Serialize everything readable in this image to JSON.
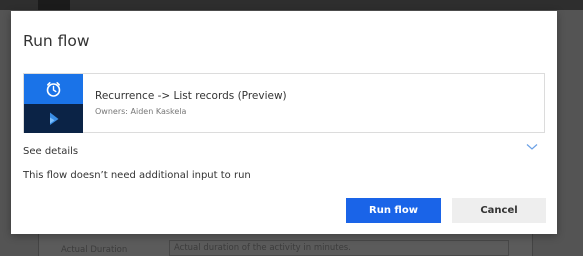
{
  "dialog": {
    "title": "Run flow",
    "flow": {
      "name": "Recurrence -> List records (Preview)",
      "owners": "Owners: Aiden Kaskela",
      "icons": [
        "alarm-clock-icon",
        "dynamics-icon"
      ]
    },
    "see_details": "See details",
    "message": "This flow doesn’t need additional input to run",
    "buttons": {
      "run": "Run flow",
      "cancel": "Cancel"
    }
  },
  "background": {
    "field_label": "Actual Duration",
    "field_value": "Actual duration of the activity in minutes."
  },
  "colors": {
    "primary": "#1a64e8",
    "icon_top": "#1a73e8",
    "icon_bottom": "#0b2346",
    "overlay": "#545454"
  }
}
